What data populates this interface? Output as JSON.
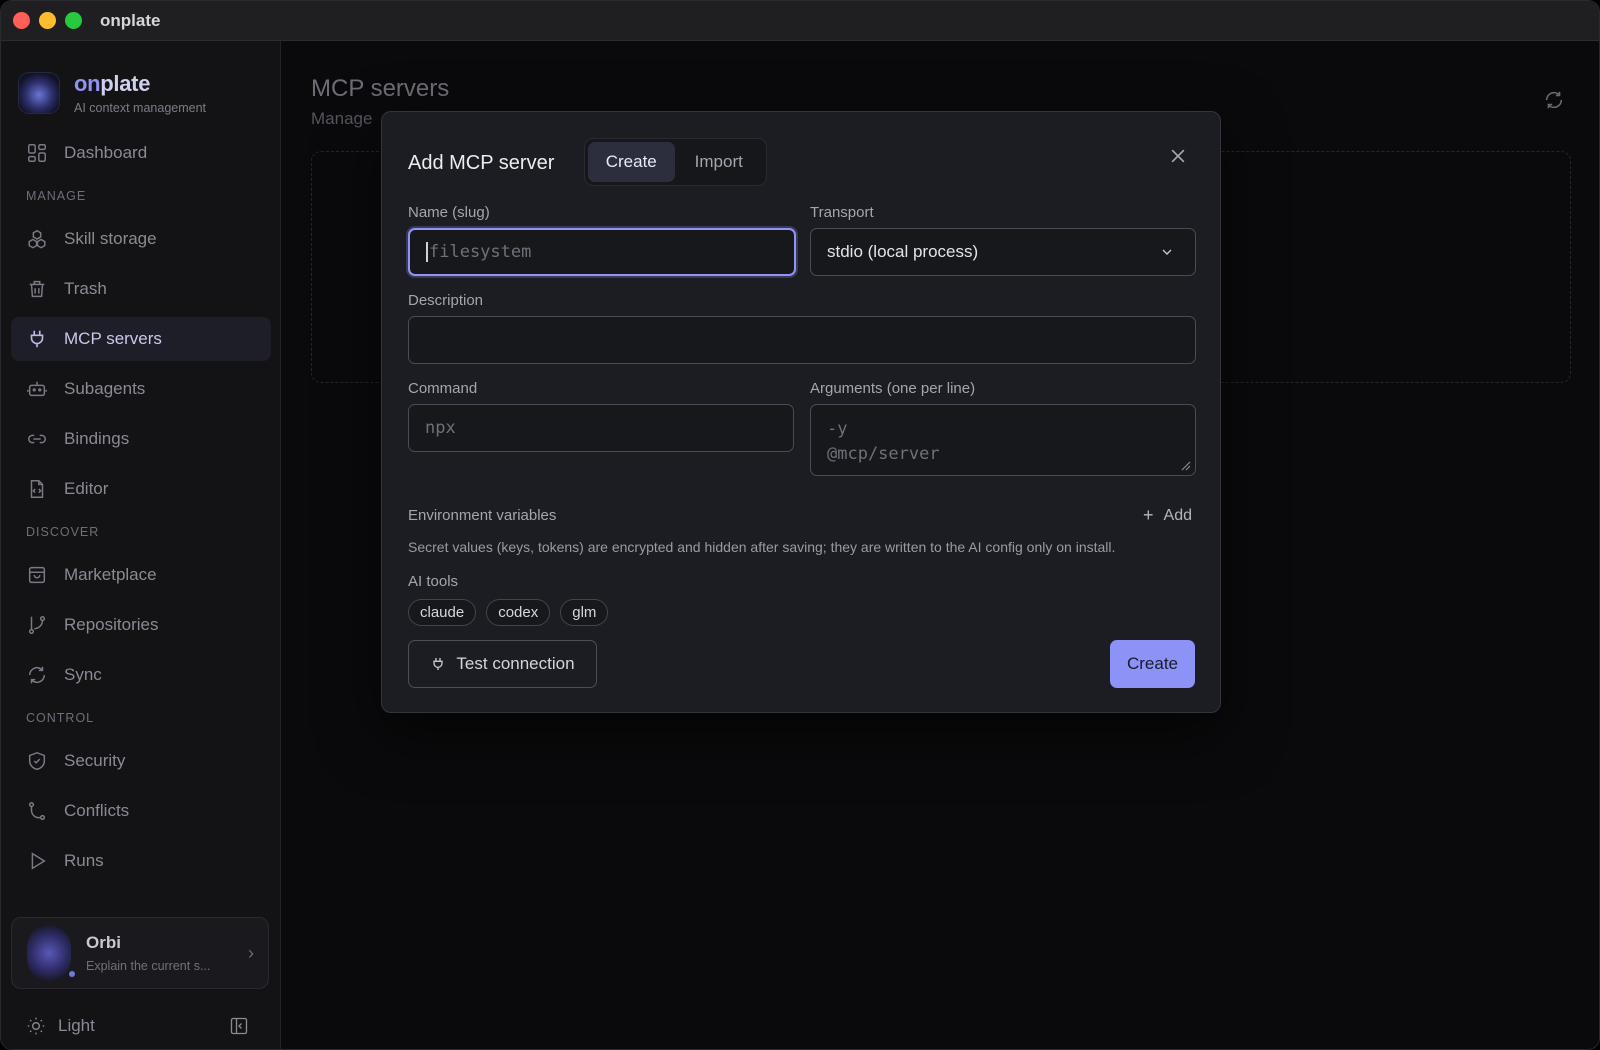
{
  "window": {
    "title": "onplate"
  },
  "brand": {
    "name_prefix": "on",
    "name_suffix": "plate",
    "subtitle": "AI context management"
  },
  "sidebar": {
    "dashboard": "Dashboard",
    "section_manage": "MANAGE",
    "skill_storage": "Skill storage",
    "trash": "Trash",
    "mcp_servers": "MCP servers",
    "subagents": "Subagents",
    "bindings": "Bindings",
    "editor": "Editor",
    "section_discover": "DISCOVER",
    "marketplace": "Marketplace",
    "repositories": "Repositories",
    "sync": "Sync",
    "section_control": "CONTROL",
    "security": "Security",
    "conflicts": "Conflicts",
    "runs": "Runs",
    "active_item": "MCP servers"
  },
  "assistant": {
    "name": "Orbi",
    "preview": "Explain the current s..."
  },
  "theme": {
    "label": "Light"
  },
  "main": {
    "title": "MCP servers",
    "subtitle_fragment": "Manage"
  },
  "modal": {
    "title": "Add MCP server",
    "tabs": {
      "create": "Create",
      "import": "Import",
      "active": "Create"
    },
    "name": {
      "label": "Name (slug)",
      "placeholder": "filesystem"
    },
    "transport": {
      "label": "Transport",
      "value": "stdio (local process)"
    },
    "description": {
      "label": "Description",
      "value": ""
    },
    "command": {
      "label": "Command",
      "placeholder": "npx"
    },
    "arguments": {
      "label": "Arguments (one per line)",
      "placeholder_lines": [
        "-y",
        "@mcp/server"
      ]
    },
    "env": {
      "label": "Environment variables",
      "add_label": "Add",
      "note": "Secret values (keys, tokens) are encrypted and hidden after saving; they are written to the AI config only on install."
    },
    "ai_tools": {
      "label": "AI tools",
      "items": [
        "claude",
        "codex",
        "glm"
      ]
    },
    "test_button": "Test connection",
    "create_button": "Create"
  },
  "colors": {
    "accent": "#8d93f6",
    "background": "#0b0b0d",
    "sidebar": "#131316",
    "modal": "#1c1d22"
  },
  "icons": {
    "dashboard": "grid-icon",
    "skill_storage": "cubes-icon",
    "trash": "trash-icon",
    "mcp": "plug-icon",
    "subagents": "robot-icon",
    "bindings": "link-icon",
    "editor": "code-file-icon",
    "marketplace": "bag-icon",
    "repositories": "branch-icon",
    "sync": "sync-icon",
    "security": "shield-icon",
    "conflicts": "merge-icon",
    "runs": "play-icon",
    "theme": "sun-icon",
    "collapse": "sidebar-collapse-icon",
    "refresh": "refresh-icon",
    "close": "close-icon",
    "chevron": "chevron-down-icon"
  }
}
